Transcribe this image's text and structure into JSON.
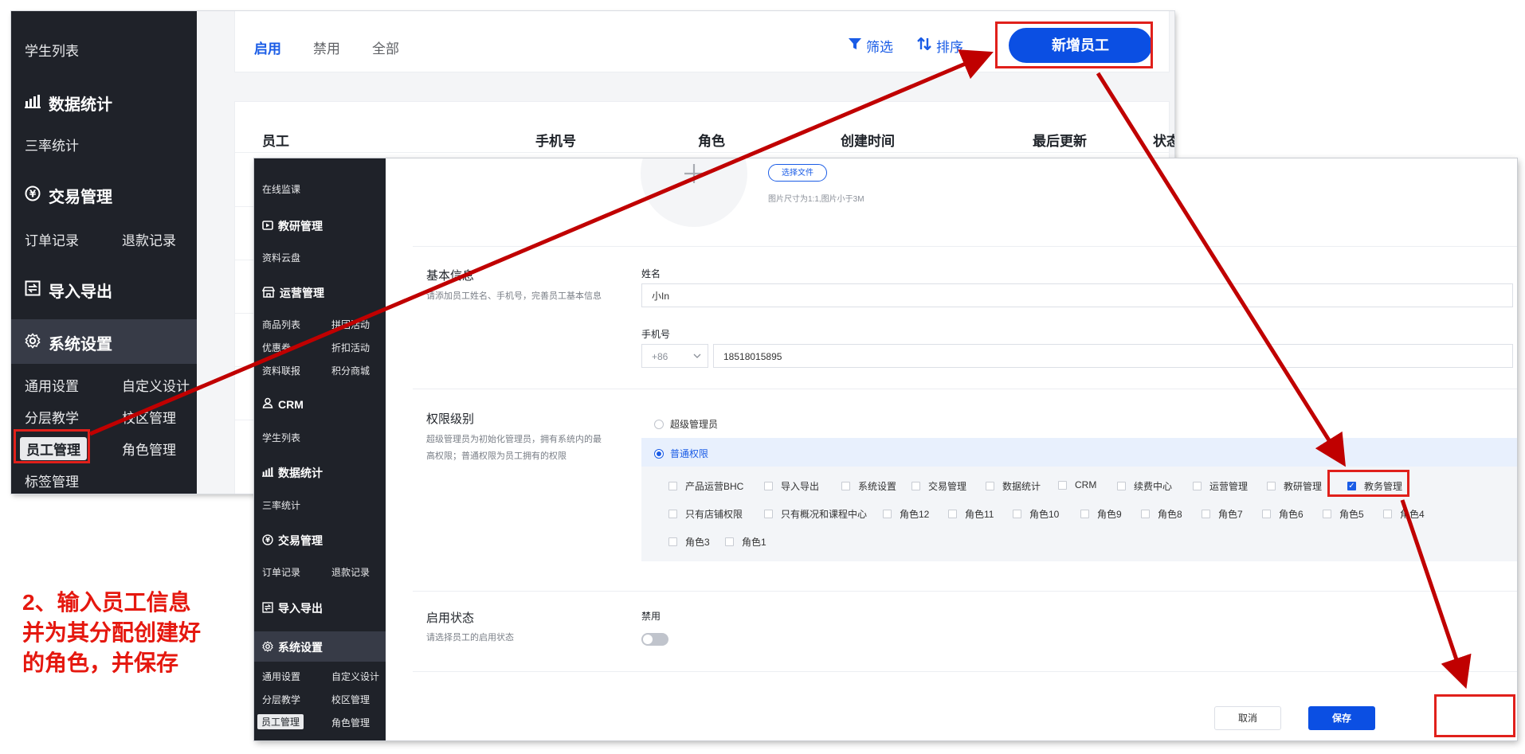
{
  "screenshot_a": {
    "sidebar": {
      "items_top": [
        "学生列表"
      ],
      "groups": [
        {
          "icon": "bar-chart-icon",
          "label": "数据统计",
          "children": [
            "三率统计"
          ]
        },
        {
          "icon": "yen-circle-icon",
          "label": "交易管理",
          "children": [
            "订单记录",
            "退款记录"
          ]
        },
        {
          "icon": "import-export-icon",
          "label": "导入导出",
          "children": []
        },
        {
          "icon": "gear-icon",
          "label": "系统设置",
          "children": [
            "通用设置",
            "自定义设计",
            "分层教学",
            "校区管理",
            "员工管理",
            "角色管理",
            "标签管理"
          ]
        }
      ],
      "active_item": "员工管理"
    },
    "tabs": [
      "启用",
      "禁用",
      "全部"
    ],
    "active_tab": "启用",
    "filter_label": "筛选",
    "sort_label": "排序",
    "new_button": "新增员工",
    "table_headers": [
      "员工",
      "手机号",
      "角色",
      "创建时间",
      "最后更新",
      "状态"
    ]
  },
  "screenshot_b": {
    "sidebar": {
      "items_top": [
        "在线监课"
      ],
      "groups": [
        {
          "icon": "video-icon",
          "label": "教研管理",
          "children": [
            "资料云盘"
          ]
        },
        {
          "icon": "store-icon",
          "label": "运营管理",
          "children": [
            "商品列表",
            "拼团活动",
            "优惠券",
            "折扣活动",
            "资料联报",
            "积分商城"
          ]
        },
        {
          "icon": "user-icon",
          "label": "CRM",
          "children": [
            "学生列表"
          ]
        },
        {
          "icon": "bar-chart-icon",
          "label": "数据统计",
          "children": [
            "三率统计"
          ]
        },
        {
          "icon": "yen-circle-icon",
          "label": "交易管理",
          "children": [
            "订单记录",
            "退款记录"
          ]
        },
        {
          "icon": "import-export-icon",
          "label": "导入导出",
          "children": []
        },
        {
          "icon": "gear-icon",
          "label": "系统设置",
          "children": [
            "通用设置",
            "自定义设计",
            "分层教学",
            "校区管理",
            "员工管理",
            "角色管理"
          ]
        }
      ],
      "active_item": "员工管理"
    },
    "avatar": {
      "choose_file": "选择文件",
      "hint": "图片尺寸为1:1,图片小于3M"
    },
    "basic_info": {
      "title": "基本信息",
      "desc": "请添加员工姓名、手机号，完善员工基本信息",
      "name_label": "姓名",
      "name_value": "小In",
      "phone_label": "手机号",
      "country_code": "+86",
      "phone_value": "18518015895"
    },
    "permission": {
      "title": "权限级别",
      "desc": "超级管理员为初始化管理员，拥有系统内的最高权限；普通权限为员工拥有的权限",
      "options": [
        "超级管理员",
        "普通权限"
      ],
      "selected": "普通权限",
      "roles_row1": [
        "产品运营BHC",
        "导入导出",
        "系统设置",
        "交易管理",
        "数据统计",
        "CRM",
        "续费中心",
        "运营管理",
        "教研管理",
        "教务管理"
      ],
      "roles_row2": [
        "只有店铺权限",
        "只有概况和课程中心",
        "角色12",
        "角色11",
        "角色10",
        "角色9",
        "角色8",
        "角色7",
        "角色6",
        "角色5",
        "角色4"
      ],
      "roles_row3": [
        "角色3",
        "角色1"
      ],
      "checked": "教务管理"
    },
    "status": {
      "title": "启用状态",
      "desc": "请选择员工的启用状态",
      "label": "禁用"
    },
    "buttons": {
      "cancel": "取消",
      "save": "保存"
    }
  },
  "annotation": {
    "note_lines": [
      "2、输入员工信息",
      "并为其分配创建好",
      "的角色，并保存"
    ],
    "color": "#e5180f"
  }
}
